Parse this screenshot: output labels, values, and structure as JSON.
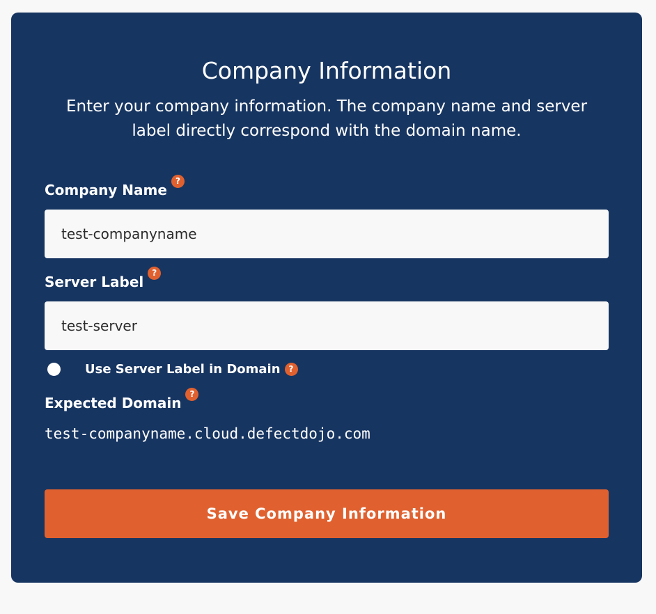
{
  "form": {
    "title": "Company Information",
    "description": "Enter your company information. The company name and server label directly correspond with the domain name.",
    "company_name": {
      "label": "Company Name",
      "value": "test-companyname",
      "help_icon": "question-mark-icon"
    },
    "server_label": {
      "label": "Server Label",
      "value": "test-server",
      "help_icon": "question-mark-icon"
    },
    "use_server_label_toggle": {
      "label": "Use Server Label in Domain",
      "enabled": false,
      "help_icon": "question-mark-icon"
    },
    "expected_domain": {
      "label": "Expected Domain",
      "value": "test-companyname.cloud.defectdojo.com",
      "help_icon": "question-mark-icon"
    },
    "save_button_label": "Save Company Information",
    "help_glyph": "?"
  },
  "colors": {
    "page_background": "#f8f8f8",
    "card_background": "#173561",
    "accent": "#e0612f",
    "text_on_card": "#ffffff",
    "input_background": "#f8f8f8"
  }
}
